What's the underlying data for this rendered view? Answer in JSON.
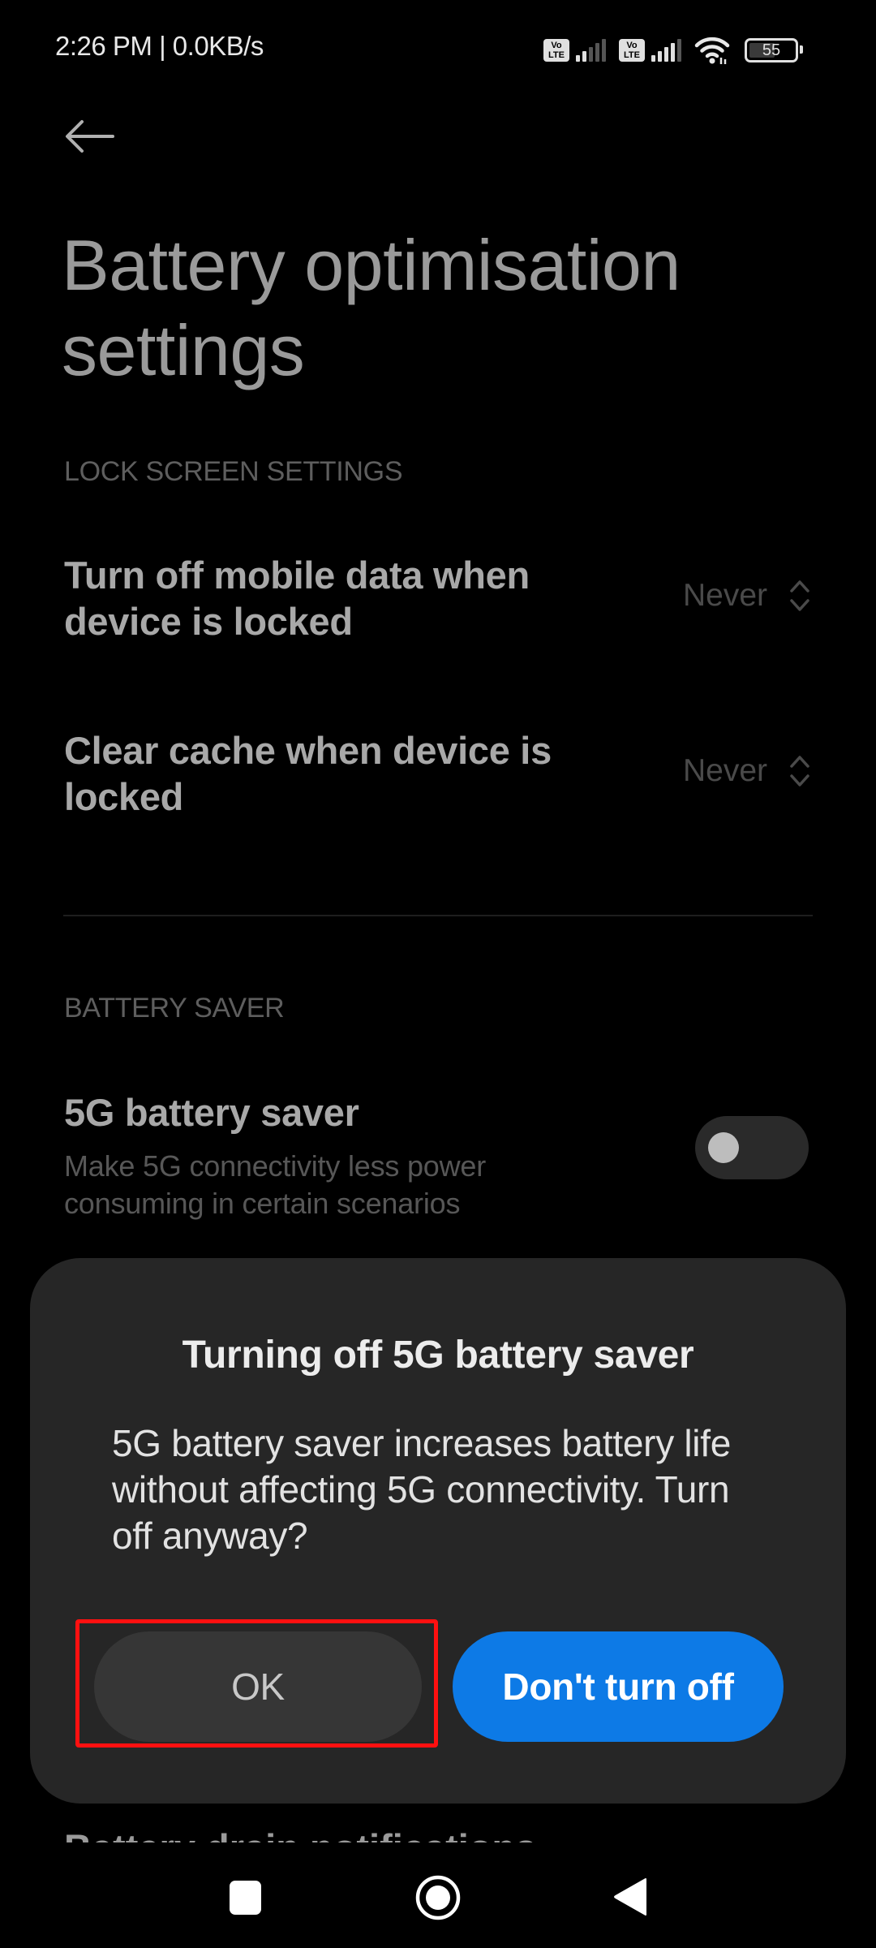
{
  "status_bar": {
    "time": "2:26 PM | 0.0KB/s",
    "volte_label_top": "Vo",
    "volte_label_bottom": "LTE",
    "battery_level": "55",
    "icons": [
      "volte-icon",
      "signal-icon",
      "volte-icon",
      "signal-icon",
      "wifi-icon",
      "battery-icon"
    ]
  },
  "header": {
    "back_icon": "arrow-left-icon",
    "title": "Battery optimisation settings"
  },
  "sections": [
    {
      "header": "LOCK SCREEN SETTINGS",
      "items": [
        {
          "title": "Turn off mobile data when device is locked",
          "value": "Never",
          "icon": "chevron-up-down-icon"
        },
        {
          "title": "Clear cache when device is locked",
          "value": "Never",
          "icon": "chevron-up-down-icon"
        }
      ]
    },
    {
      "header": "BATTERY SAVER",
      "items": [
        {
          "title": "5G battery saver",
          "subtitle": "Make 5G connectivity less power consuming in certain scenarios",
          "toggle_on": false
        },
        {
          "title": "Battery drain notifications"
        }
      ]
    }
  ],
  "dialog": {
    "title": "Turning off 5G battery saver",
    "body": "5G battery saver increases battery life without affecting 5G connectivity. Turn off anyway?",
    "ok_label": "OK",
    "cancel_label": "Don't turn off",
    "highlighted_button": "OK",
    "colors": {
      "primary": "#0d7ae6",
      "highlight": "#ff1010",
      "surface": "#262626"
    }
  },
  "nav_bar": {
    "buttons": [
      "recents-icon",
      "home-icon",
      "back-icon"
    ]
  }
}
